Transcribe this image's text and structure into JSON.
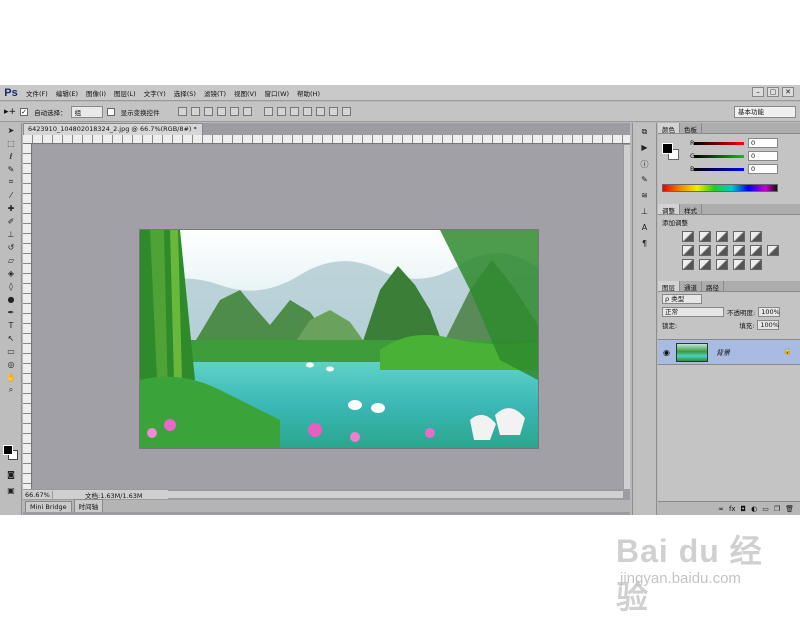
{
  "app": {
    "logo": "Ps"
  },
  "menu": [
    "文件(F)",
    "编辑(E)",
    "图像(I)",
    "图层(L)",
    "文字(Y)",
    "选择(S)",
    "滤镜(T)",
    "视图(V)",
    "窗口(W)",
    "帮助(H)"
  ],
  "window_controls": [
    "–",
    "▢",
    "✕"
  ],
  "options": {
    "auto_select_label": "自动选择：",
    "auto_select_value": "组",
    "show_transform_label": "显示变换控件",
    "workspace": "基本功能"
  },
  "document": {
    "tab_title": "6423910_104802018324_2.jpg @ 66.7%(RGB/8#) *",
    "zoom": "66.67%",
    "doc_info": "文档:1.63M/1.63M"
  },
  "bottom_tabs": [
    "Mini Bridge",
    "时间轴"
  ],
  "color_panel": {
    "tabs": [
      "颜色",
      "色板"
    ],
    "channels": [
      {
        "label": "R",
        "value": "0",
        "color": "#d21010"
      },
      {
        "label": "G",
        "value": "0",
        "color": "#10a010"
      },
      {
        "label": "B",
        "value": "0",
        "color": "#1020d0"
      }
    ]
  },
  "adjust_panel": {
    "tabs": [
      "调整",
      "样式"
    ],
    "title": "添加调整"
  },
  "layers_panel": {
    "tabs": [
      "图层",
      "通道",
      "路径"
    ],
    "filter": "ρ 类型",
    "blend_mode": "正常",
    "opacity_label": "不透明度:",
    "opacity": "100%",
    "lock_label": "锁定:",
    "fill_label": "填充:",
    "fill": "100%",
    "layer_name": "背景",
    "footer_icons": [
      "∞",
      "fx",
      "◘",
      "◐",
      "▭",
      "❐",
      "🗑"
    ]
  },
  "watermark": {
    "logo": "Bai du 经验",
    "sub": "jingyan.baidu.com"
  }
}
